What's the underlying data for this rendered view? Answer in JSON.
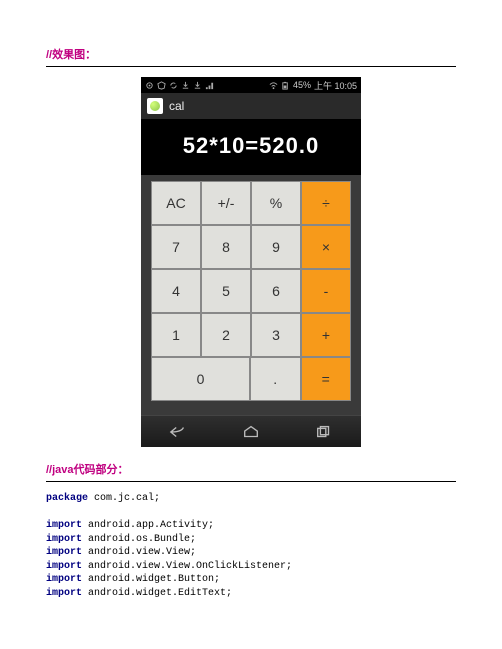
{
  "section1_title": "//效果图：",
  "section2_title": "//java代码部分：",
  "phone": {
    "status": {
      "battery_text": "45%",
      "clock": "上午 10:05"
    },
    "app_title": "cal",
    "display": "52*10=520.0",
    "keys": {
      "r1c1": "AC",
      "r1c2": "+/-",
      "r1c3": "%",
      "r1c4": "÷",
      "r2c1": "7",
      "r2c2": "8",
      "r2c3": "9",
      "r2c4": "×",
      "r3c1": "4",
      "r3c2": "5",
      "r3c3": "6",
      "r3c4": "-",
      "r4c1": "1",
      "r4c2": "2",
      "r4c3": "3",
      "r4c4": "+",
      "r5c1": "0",
      "r5c2": ".",
      "r5c3": "="
    }
  },
  "code": {
    "package_kw": "package",
    "package_rest": " com.jc.cal;",
    "import_kw": "import",
    "imports": [
      " android.app.Activity;",
      " android.os.Bundle;",
      " android.view.View;",
      " android.view.View.OnClickListener;",
      " android.widget.Button;",
      " android.widget.EditText;"
    ]
  }
}
